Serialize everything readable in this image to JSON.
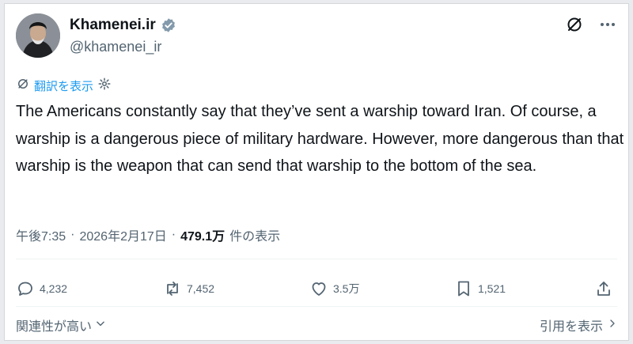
{
  "header": {
    "display_name": "Khamenei.ir",
    "handle": "@khamenei_ir",
    "verified_color": "#829aab"
  },
  "translate": {
    "label": "翻訳を表示"
  },
  "tweet": {
    "text": "The Americans constantly say that they’ve sent a warship toward Iran. Of course, a warship is a dangerous piece of military hardware. However, more dangerous than that warship is the weapon that can send that warship to the bottom of the sea."
  },
  "meta": {
    "time": "午後7:35",
    "separator": "·",
    "date": "2026年2月17日",
    "views": "479.1万",
    "views_label": "件の表示"
  },
  "actions": {
    "replies": "4,232",
    "reposts": "7,452",
    "likes": "3.5万",
    "bookmarks": "1,521"
  },
  "footer": {
    "sort_label": "関連性が高い",
    "quotes_label": "引用を表示"
  },
  "colors": {
    "link": "#1d9bf0",
    "secondary": "#536471",
    "text": "#0f1419"
  }
}
